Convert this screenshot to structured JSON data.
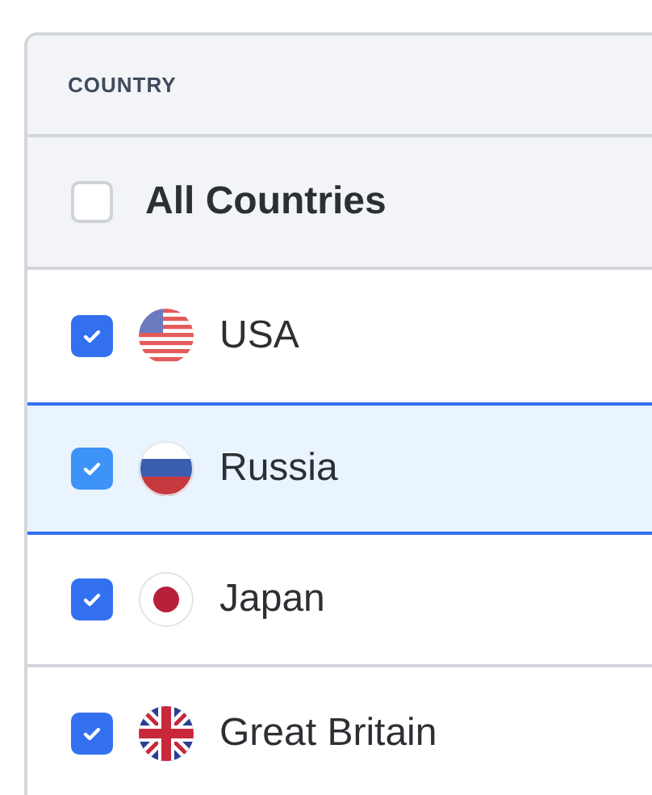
{
  "column_header": "COUNTRY",
  "all_countries": {
    "label": "All Countries",
    "checked": false
  },
  "rows": [
    {
      "label": "USA",
      "checked": true,
      "selected": false
    },
    {
      "label": "Russia",
      "checked": true,
      "selected": true
    },
    {
      "label": "Japan",
      "checked": true,
      "selected": false
    },
    {
      "label": "Great Britain",
      "checked": true,
      "selected": false
    }
  ]
}
